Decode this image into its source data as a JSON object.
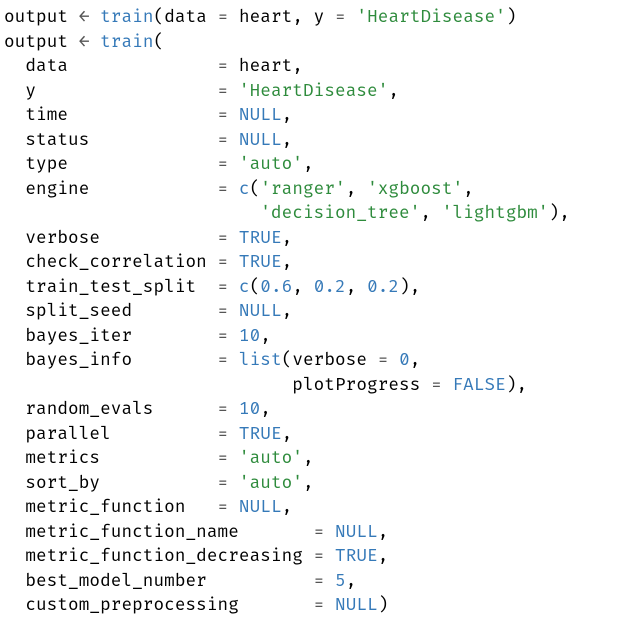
{
  "code": {
    "l1": {
      "a": "output ",
      "b": "←",
      "c": " ",
      "d": "train",
      "e": "(data ",
      "f": "=",
      "g": " heart, y ",
      "h": "=",
      "i": " ",
      "j": "'HeartDisease'",
      "k": ")"
    },
    "l2": {
      "a": "output ",
      "b": "←",
      "c": " ",
      "d": "train",
      "e": "("
    },
    "l3": {
      "a": "  data              ",
      "b": "=",
      "c": " heart,"
    },
    "l4": {
      "a": "  y                 ",
      "b": "=",
      "c": " ",
      "d": "'HeartDisease'",
      "e": ","
    },
    "l5": {
      "a": "  time              ",
      "b": "=",
      "c": " ",
      "d": "NULL",
      "e": ","
    },
    "l6": {
      "a": "  status            ",
      "b": "=",
      "c": " ",
      "d": "NULL",
      "e": ","
    },
    "l7": {
      "a": "  type              ",
      "b": "=",
      "c": " ",
      "d": "'auto'",
      "e": ","
    },
    "l8": {
      "a": "  engine            ",
      "b": "=",
      "c": " ",
      "d": "c",
      "e": "(",
      "f": "'ranger'",
      "g": ", ",
      "h": "'xgboost'",
      "i": ","
    },
    "l9": {
      "a": "                        ",
      "b": "'decision_tree'",
      "c": ", ",
      "d": "'lightgbm'",
      "e": "),"
    },
    "l10": {
      "a": "  verbose           ",
      "b": "=",
      "c": " ",
      "d": "TRUE",
      "e": ","
    },
    "l11": {
      "a": "  check_correlation ",
      "b": "=",
      "c": " ",
      "d": "TRUE",
      "e": ","
    },
    "l12": {
      "a": "  train_test_split  ",
      "b": "=",
      "c": " ",
      "d": "c",
      "e": "(",
      "f": "0.6",
      "g": ", ",
      "h": "0.2",
      "i": ", ",
      "j": "0.2",
      "k": "),"
    },
    "l13": {
      "a": "  split_seed        ",
      "b": "=",
      "c": " ",
      "d": "NULL",
      "e": ","
    },
    "l14": {
      "a": "  bayes_iter        ",
      "b": "=",
      "c": " ",
      "d": "10",
      "e": ","
    },
    "l15": {
      "a": "  bayes_info        ",
      "b": "=",
      "c": " ",
      "d": "list",
      "e": "(verbose ",
      "f": "=",
      "g": " ",
      "h": "0",
      "i": ","
    },
    "l16": {
      "a": "                           plotProgress ",
      "b": "=",
      "c": " ",
      "d": "FALSE",
      "e": "),"
    },
    "l17": {
      "a": "  random_evals      ",
      "b": "=",
      "c": " ",
      "d": "10",
      "e": ","
    },
    "l18": {
      "a": "  parallel          ",
      "b": "=",
      "c": " ",
      "d": "TRUE",
      "e": ","
    },
    "l19": {
      "a": "  metrics           ",
      "b": "=",
      "c": " ",
      "d": "'auto'",
      "e": ","
    },
    "l20": {
      "a": "  sort_by           ",
      "b": "=",
      "c": " ",
      "d": "'auto'",
      "e": ","
    },
    "l21": {
      "a": "  metric_function   ",
      "b": "=",
      "c": " ",
      "d": "NULL",
      "e": ","
    },
    "l22": {
      "a": "  metric_function_name       ",
      "b": "=",
      "c": " ",
      "d": "NULL",
      "e": ","
    },
    "l23": {
      "a": "  metric_function_decreasing ",
      "b": "=",
      "c": " ",
      "d": "TRUE",
      "e": ","
    },
    "l24": {
      "a": "  best_model_number          ",
      "b": "=",
      "c": " ",
      "d": "5",
      "e": ","
    },
    "l25": {
      "a": "  custom_preprocessing       ",
      "b": "=",
      "c": " ",
      "d": "NULL",
      "e": ")"
    }
  }
}
